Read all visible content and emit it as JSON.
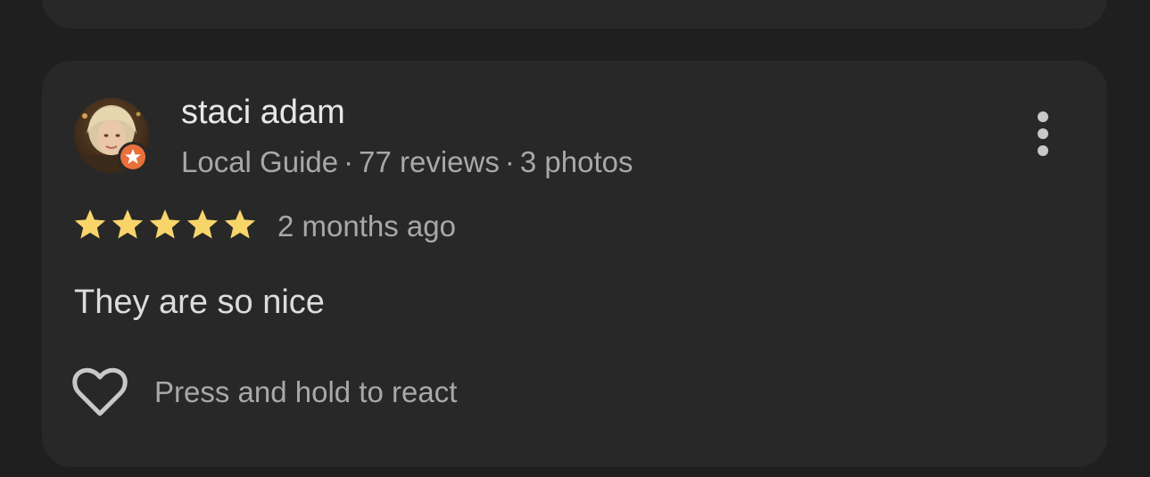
{
  "previous_review": {},
  "review": {
    "reviewer": {
      "name": "staci adam",
      "badge": "Local Guide",
      "reviews_count": "77 reviews",
      "photos_count": "3 photos",
      "separator": "·"
    },
    "rating": {
      "value": 5,
      "max": 5
    },
    "time_ago": "2 months ago",
    "text": "They are so nice",
    "react_label": "Press and hold to react",
    "icons": {
      "avatar": "avatar-photo",
      "local_guide_badge": "local-guide-star-badge-icon",
      "more": "more-vertical-icon",
      "star": "star-icon",
      "react": "heart-outline-icon"
    }
  },
  "colors": {
    "background": "#1f1f1f",
    "card": "#282828",
    "star": "#f8d56b",
    "badge": "#e8703a",
    "primary_text": "#e8e8e8",
    "secondary_text": "#a8a8a8"
  }
}
